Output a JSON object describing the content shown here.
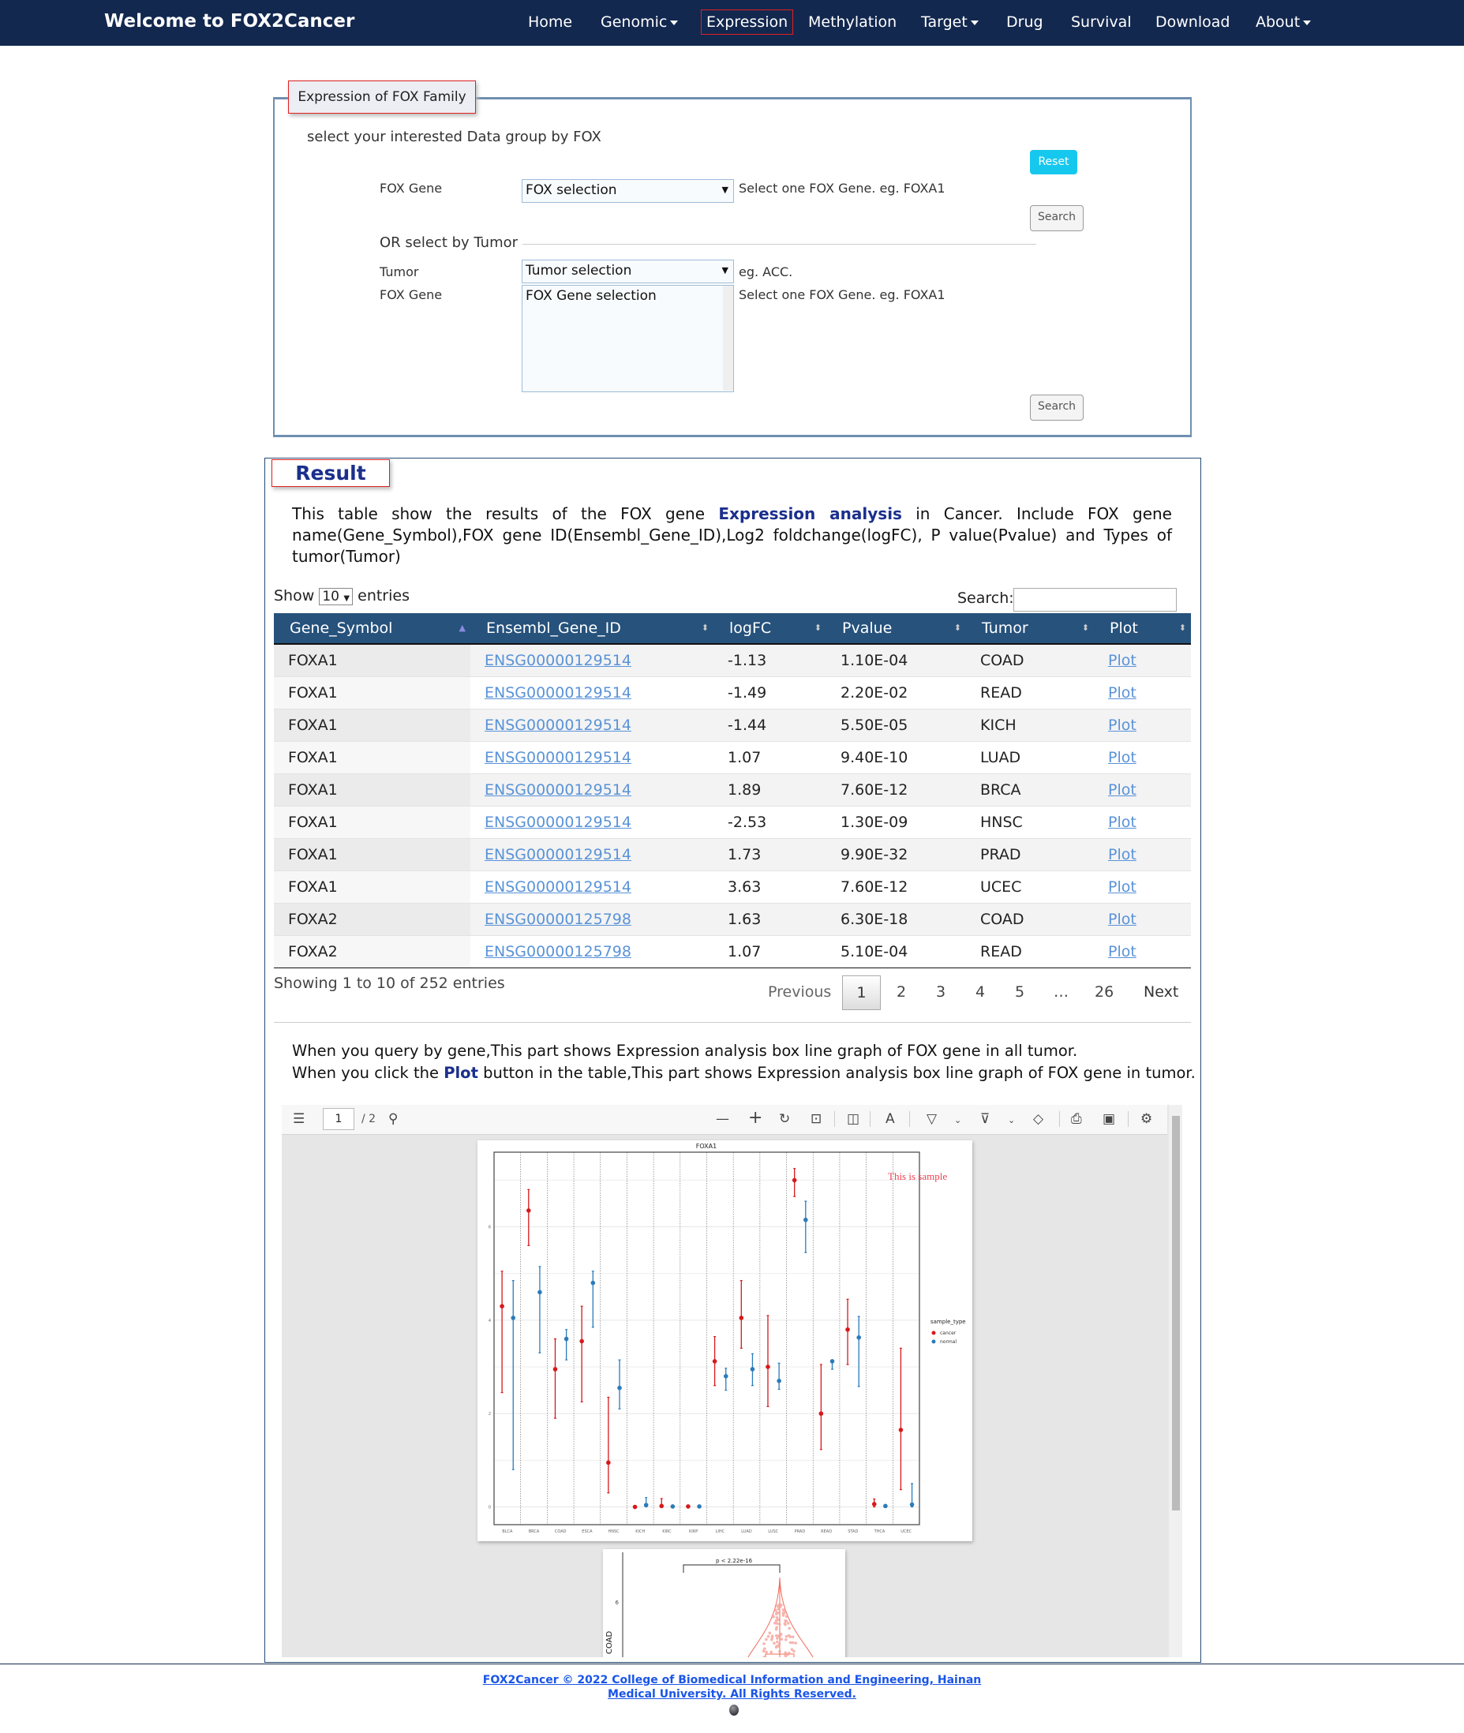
{
  "nav": {
    "brand": "Welcome to FOX2Cancer",
    "items": [
      {
        "label": "Home"
      },
      {
        "label": "Genomic",
        "dropdown": true
      },
      {
        "label": "Expression",
        "active": true
      },
      {
        "label": "Methylation"
      },
      {
        "label": "Target",
        "dropdown": true
      },
      {
        "label": "Drug"
      },
      {
        "label": "Survival"
      },
      {
        "label": "Download"
      },
      {
        "label": "About",
        "dropdown": true
      }
    ]
  },
  "form": {
    "legend": "Expression of FOX Family",
    "intro": "select your interested Data group by FOX",
    "reset": "Reset",
    "search": "Search",
    "fox_label": "FOX Gene",
    "fox_select": "FOX selection",
    "fox_hint": "Select one FOX Gene. eg. FOXA1",
    "or_tumor": "OR select by Tumor",
    "tumor_label": "Tumor",
    "tumor_select": "Tumor selection",
    "tumor_hint": "eg. ACC.",
    "gene_label": "FOX Gene",
    "gene_list": "FOX Gene selection",
    "gene_hint": "Select one FOX Gene. eg. FOXA1"
  },
  "result": {
    "title": "Result",
    "desc_pre": "This table show the results of the FOX gene ",
    "desc_bold": "Expression analysis",
    "desc_post": " in Cancer. Include FOX gene name(Gene_Symbol),FOX gene ID(Ensembl_Gene_ID),Log2 foldchange(logFC), P value(Pvalue) and Types of tumor(Tumor)",
    "show": "Show",
    "entries_value": "10",
    "entries": "entries",
    "search_label": "Search:",
    "search_value": "",
    "columns": [
      "Gene_Symbol",
      "Ensembl_Gene_ID",
      "logFC",
      "Pvalue",
      "Tumor",
      "Plot"
    ],
    "rows": [
      [
        "FOXA1",
        "ENSG00000129514",
        "-1.13",
        "1.10E-04",
        "COAD",
        "Plot"
      ],
      [
        "FOXA1",
        "ENSG00000129514",
        "-1.49",
        "2.20E-02",
        "READ",
        "Plot"
      ],
      [
        "FOXA1",
        "ENSG00000129514",
        "-1.44",
        "5.50E-05",
        "KICH",
        "Plot"
      ],
      [
        "FOXA1",
        "ENSG00000129514",
        "1.07",
        "9.40E-10",
        "LUAD",
        "Plot"
      ],
      [
        "FOXA1",
        "ENSG00000129514",
        "1.89",
        "7.60E-12",
        "BRCA",
        "Plot"
      ],
      [
        "FOXA1",
        "ENSG00000129514",
        "-2.53",
        "1.30E-09",
        "HNSC",
        "Plot"
      ],
      [
        "FOXA1",
        "ENSG00000129514",
        "1.73",
        "9.90E-32",
        "PRAD",
        "Plot"
      ],
      [
        "FOXA1",
        "ENSG00000129514",
        "3.63",
        "7.60E-12",
        "UCEC",
        "Plot"
      ],
      [
        "FOXA2",
        "ENSG00000125798",
        "1.63",
        "6.30E-18",
        "COAD",
        "Plot"
      ],
      [
        "FOXA2",
        "ENSG00000125798",
        "1.07",
        "5.10E-04",
        "READ",
        "Plot"
      ]
    ],
    "info": "Showing 1 to 10 of 252 entries",
    "pagination": {
      "previous": "Previous",
      "pages": [
        "1",
        "2",
        "3",
        "4",
        "5",
        "…",
        "26"
      ],
      "current": "1",
      "next": "Next"
    },
    "note1": "When you query by gene,This part shows Expression analysis box line graph of FOX gene in all tumor.",
    "note2_pre": "When you click the ",
    "note2_bold": "Plot",
    "note2_post": " button in the table,This part shows Expression analysis box line graph of FOX gene in tumor."
  },
  "viewer": {
    "page_input": "1",
    "page_total": "/ 2",
    "watermark": "This is sample"
  },
  "chart_data": {
    "type": "scatter",
    "title": "FOXA1",
    "xlabel": "",
    "ylabel": "",
    "ylim": [
      -0.38,
      7.6
    ],
    "yticks": [
      0,
      2,
      4,
      6
    ],
    "grid": true,
    "categories": [
      "BLCA",
      "BRCA",
      "COAD",
      "ESCA",
      "HNSC",
      "KICH",
      "KIRC",
      "KIRP",
      "LIHC",
      "LUAD",
      "LUSC",
      "PRAD",
      "READ",
      "STAD",
      "THCA",
      "UCEC"
    ],
    "legend": {
      "title": "sample_type",
      "position": "right"
    },
    "series": [
      {
        "name": "cancer",
        "color": "#d7191c",
        "values": [
          4.3,
          6.35,
          2.95,
          3.55,
          0.95,
          0.0,
          0.02,
          0.01,
          3.12,
          4.05,
          3.0,
          7.0,
          2.0,
          3.8,
          0.06,
          1.65
        ],
        "low": [
          2.45,
          5.6,
          1.9,
          2.25,
          0.3,
          0,
          0,
          0,
          2.6,
          3.4,
          2.15,
          6.65,
          1.23,
          3.05,
          0,
          0.37
        ],
        "high": [
          5.05,
          6.8,
          3.6,
          4.3,
          2.35,
          0,
          0.18,
          0,
          3.65,
          4.85,
          4.1,
          7.25,
          3.05,
          4.45,
          0.17,
          3.4
        ]
      },
      {
        "name": "normal",
        "color": "#2b7bba",
        "values": [
          4.05,
          4.6,
          3.6,
          4.8,
          2.55,
          0.04,
          0.01,
          0.01,
          2.8,
          2.95,
          2.7,
          6.15,
          3.12,
          3.63,
          0.02,
          0.05
        ],
        "low": [
          0.8,
          3.3,
          3.15,
          3.85,
          2.1,
          0,
          0,
          0,
          2.5,
          2.6,
          2.52,
          5.45,
          2.95,
          2.58,
          0,
          0
        ],
        "high": [
          4.85,
          5.15,
          3.8,
          5.05,
          3.15,
          0.2,
          0,
          0,
          2.97,
          3.28,
          3.08,
          6.55,
          3.15,
          4.08,
          0,
          0.5
        ]
      }
    ]
  },
  "page2": {
    "pvalue": "p < 2.22e-16",
    "ytick": "6",
    "ylabel": "COAD"
  },
  "footer": {
    "text": "FOX2Cancer © 2022 College of Biomedical Information and Engineering, Hainan Medical University. All Rights Reserved."
  }
}
